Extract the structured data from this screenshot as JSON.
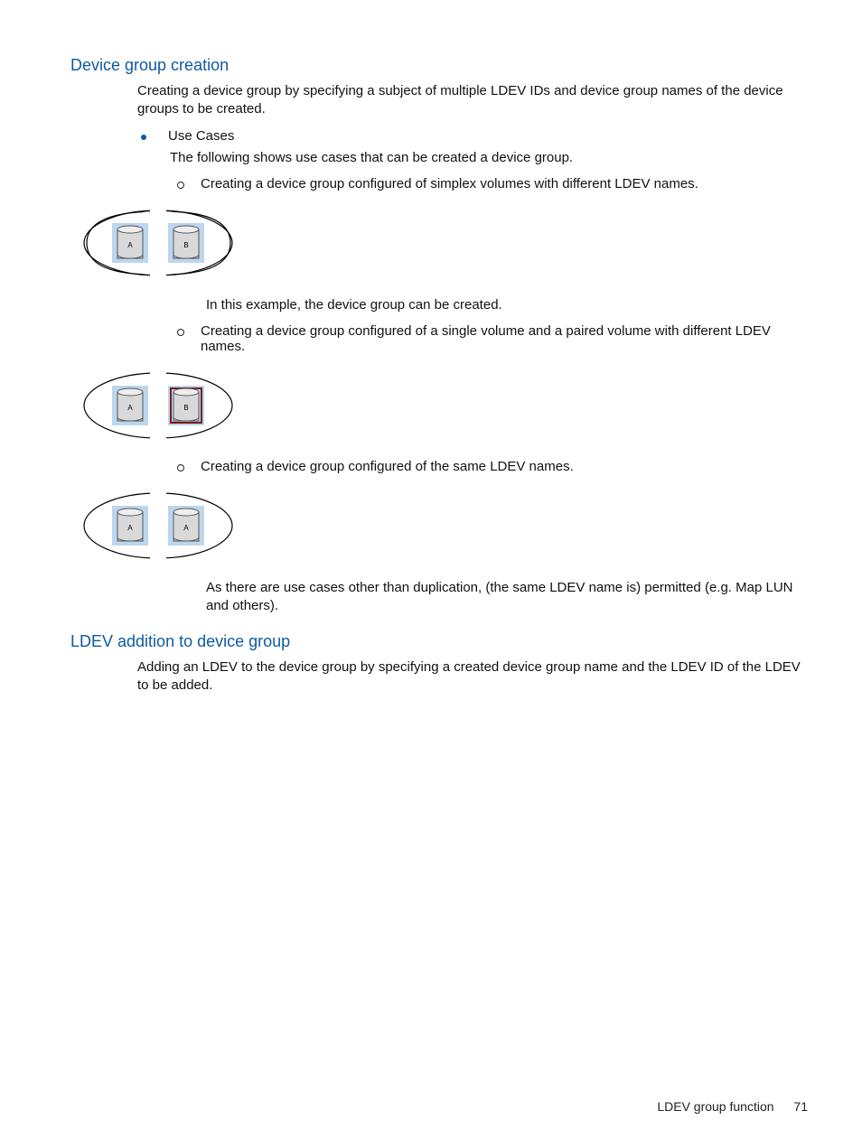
{
  "section1": {
    "title": "Device group creation",
    "intro": "Creating a device group by specifying a subject of multiple LDEV IDs and device group names of the device groups to be created.",
    "usecases_label": "Use Cases",
    "usecases_text": "The following shows use cases that can be created a device group.",
    "case1": {
      "text": "Creating a device group configured of simplex volumes with different LDEV names.",
      "volA": "A",
      "volB": "B",
      "note": "In this example, the device group can be created."
    },
    "case2": {
      "text": "Creating a device group configured of a single volume and a paired volume with different LDEV names.",
      "volA": "A",
      "volB": "B"
    },
    "case3": {
      "text": "Creating a device group configured of the same LDEV names.",
      "volA": "A",
      "volB": "A",
      "note": "As there are use cases other than duplication, (the same LDEV name is) permitted (e.g. Map LUN and others)."
    }
  },
  "section2": {
    "title": "LDEV addition to device group",
    "intro": "Adding an LDEV to the device group by specifying a created device group name and the LDEV ID of the LDEV to be added."
  },
  "footer": {
    "label": "LDEV group function",
    "page": "71"
  }
}
